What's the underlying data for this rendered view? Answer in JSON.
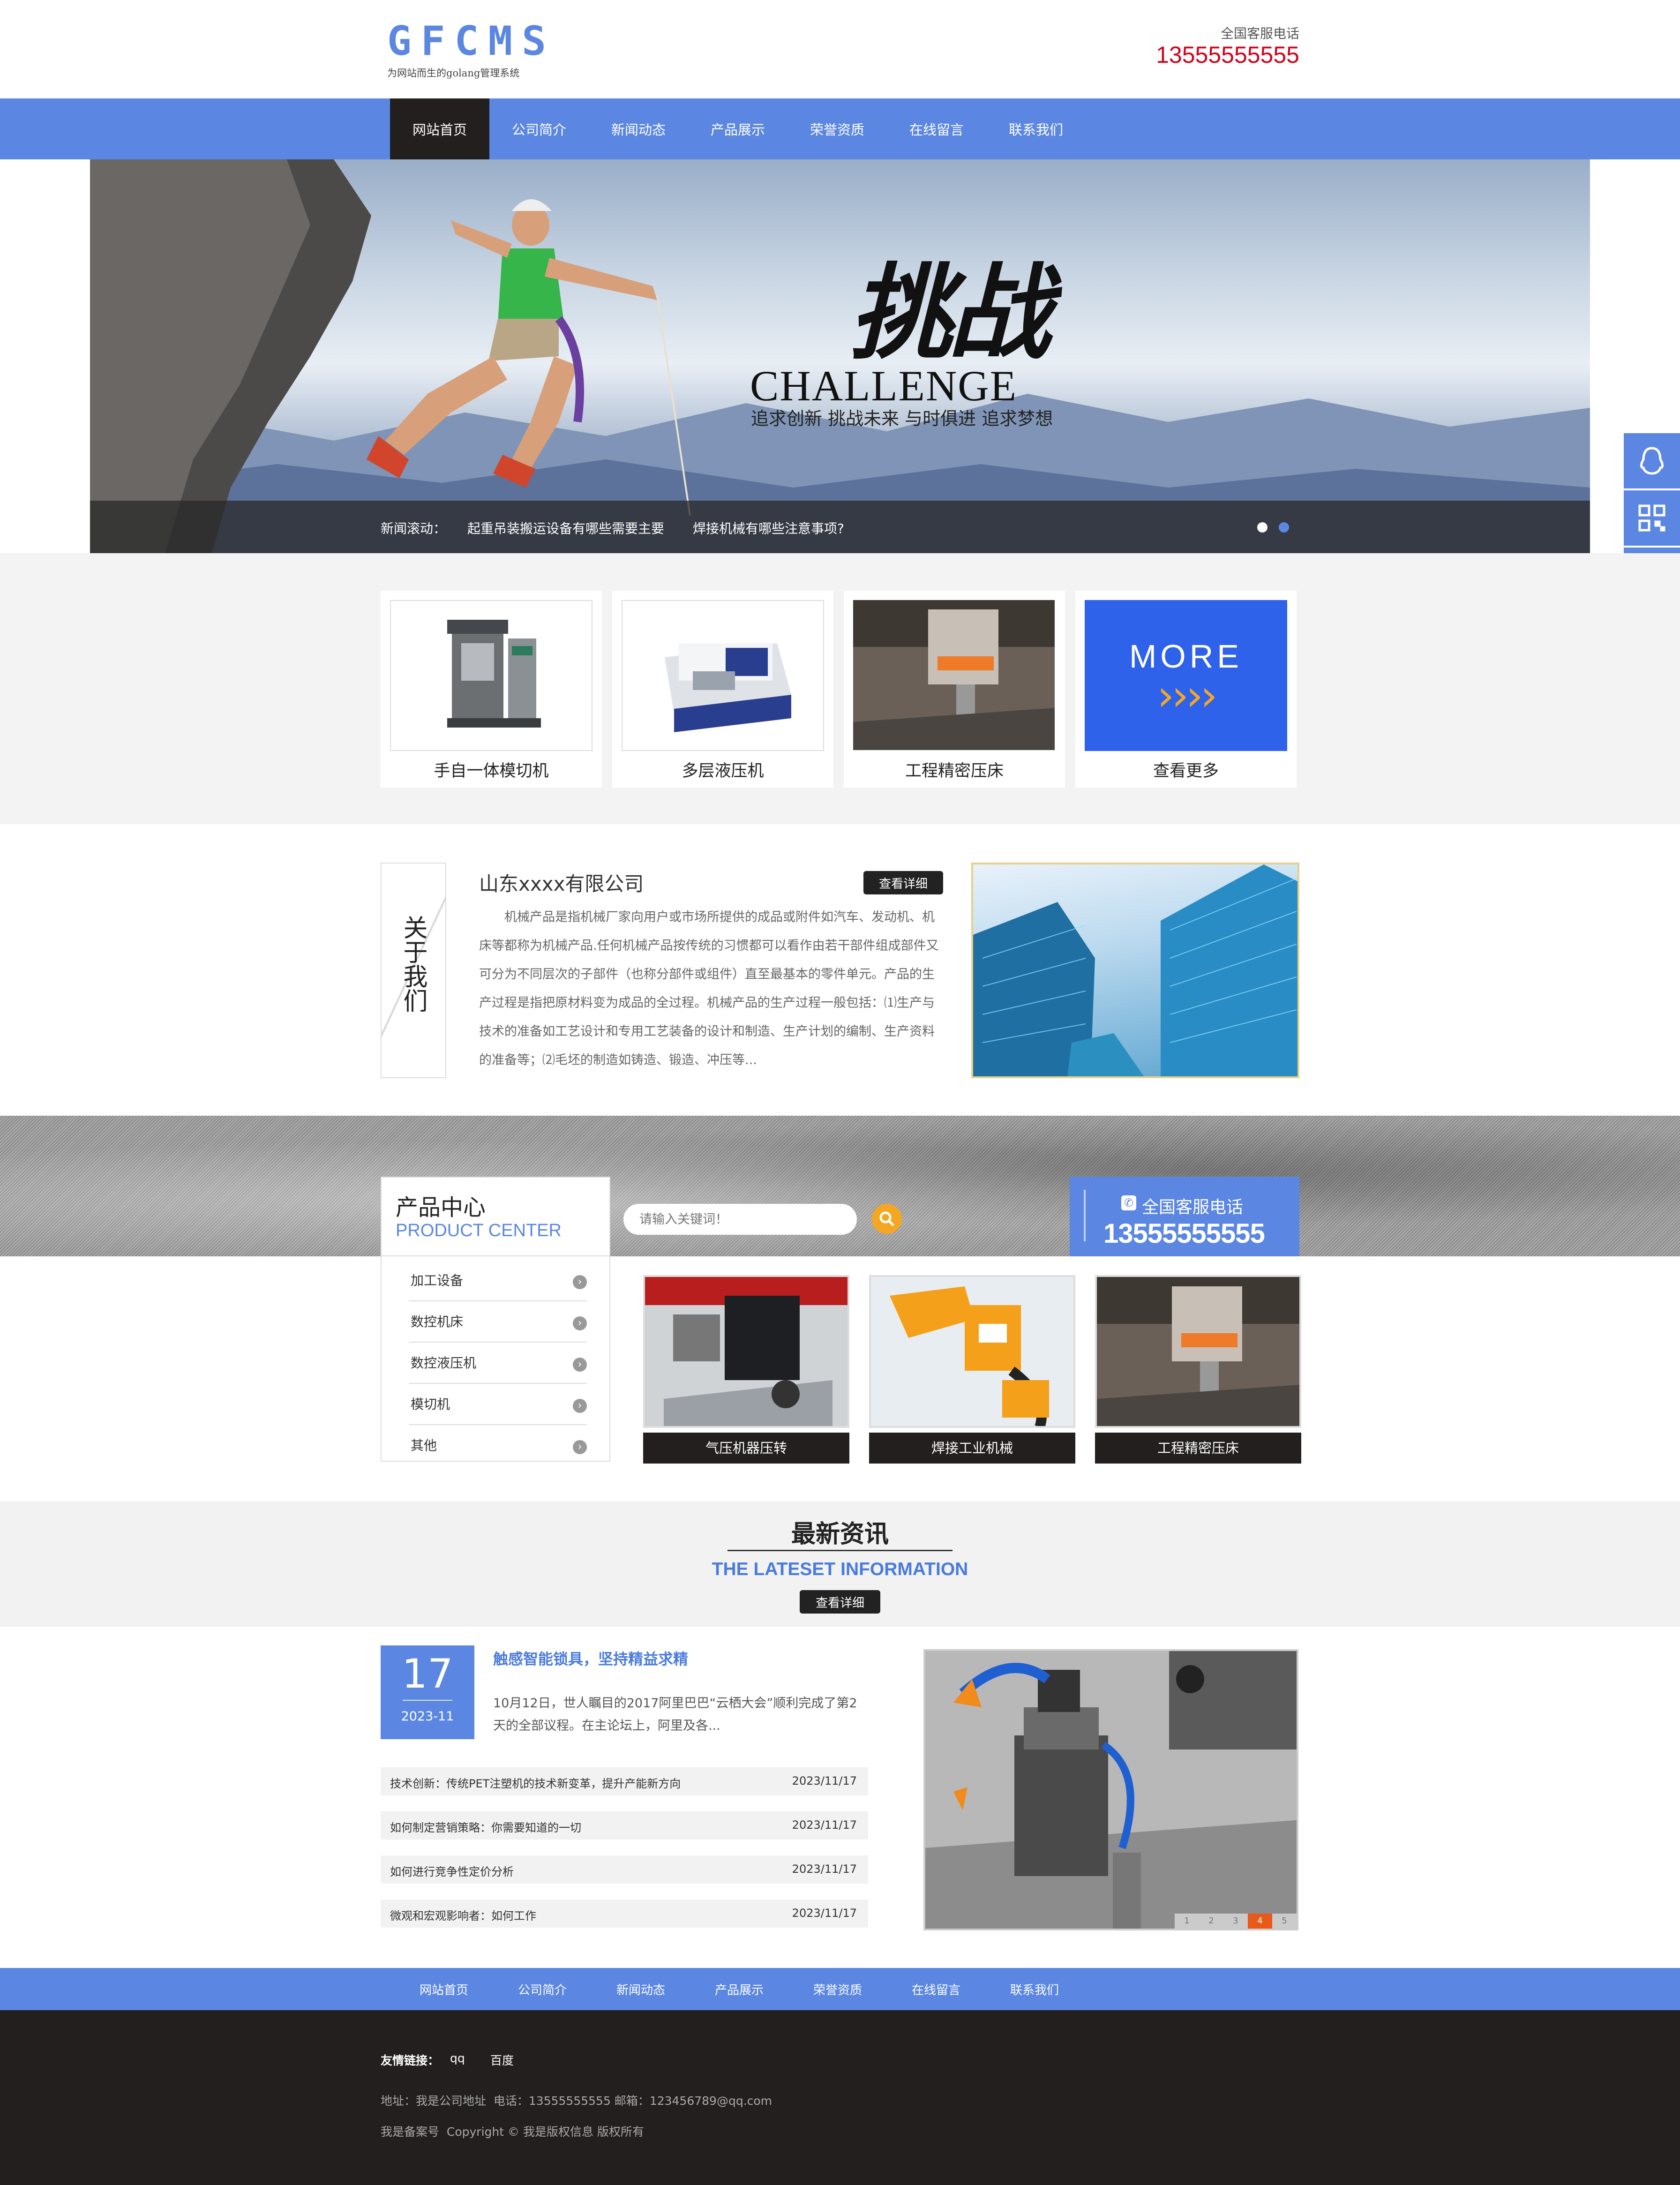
{
  "header": {
    "logo_text": "GFCMS",
    "logo_slogan": "为网站而生的golang管理系统",
    "hotline_label": "全国客服电话",
    "hotline_number": "13555555555"
  },
  "nav": {
    "items": [
      "网站首页",
      "公司简介",
      "新闻动态",
      "产品展示",
      "荣誉资质",
      "在线留言",
      "联系我们"
    ],
    "active_index": 0
  },
  "banner": {
    "title_cn": "挑战",
    "title_en": "CHALLENGE",
    "slogan": "追求创新 挑战未来 与时俱进 追求梦想",
    "ticker_label": "新闻滚动：",
    "ticker_items": [
      "起重吊装搬运设备有哪些需要主要",
      "焊接机械有哪些注意事项?"
    ],
    "slide_count": 2,
    "active_slide": 1
  },
  "featured": {
    "items": [
      {
        "label": "手自一体模切机",
        "icon": "press-machine-photo"
      },
      {
        "label": "多层液压机",
        "icon": "lathe-machine-photo"
      },
      {
        "label": "工程精密压床",
        "icon": "precision-press-photo"
      },
      {
        "label": "查看更多",
        "icon": "more-tile"
      }
    ],
    "more_tile_text": "MORE",
    "more_arrows": "››››"
  },
  "about": {
    "side_title": "关于我们",
    "company": "山东xxxx有限公司",
    "more_button": "查看详细",
    "description": "机械产品是指机械厂家向用户或市场所提供的成品或附件如汽车、发动机、机床等都称为机械产品.任何机械产品按传统的习惯都可以看作由若干部件组成部件又可分为不同层次的子部件（也称分部件或组件）直至最基本的零件单元。产品的生产过程是指把原材料变为成品的全过程。机械产品的生产过程一般包括：⑴生产与技术的准备如工艺设计和专用工艺装备的设计和制造、生产计划的编制、生产资料的准备等；⑵毛坯的制造如铸造、锻造、冲压等..."
  },
  "products": {
    "title_cn": "产品中心",
    "title_en": "PRODUCT CENTER",
    "search_placeholder": "请输入关键词！",
    "hotline_label": "全国客服电话",
    "hotline_number": "13555555555",
    "categories": [
      "加工设备",
      "数控机床",
      "数控液压机",
      "模切机",
      "其他"
    ],
    "items": [
      {
        "label": "气压机器压转"
      },
      {
        "label": "焊接工业机械"
      },
      {
        "label": "工程精密压床"
      }
    ]
  },
  "news": {
    "title_cn": "最新资讯",
    "title_en": "THE LATESET INFORMATION",
    "more_button": "查看详细",
    "featured": {
      "day": "17",
      "month": "2023-11",
      "title": "触感智能锁具，坚持精益求精",
      "summary": "10月12日，世人瞩目的2017阿里巴巴“云栖大会”顺利完成了第2天的全部议程。在主论坛上，阿里及各..."
    },
    "list": [
      {
        "title": "技术创新：传统PET注塑机的技术新变革，提升产能新方向",
        "date": "2023/11/17"
      },
      {
        "title": "如何制定营销策略：你需要知道的一切",
        "date": "2023/11/17"
      },
      {
        "title": "如何进行竞争性定价分析",
        "date": "2023/11/17"
      },
      {
        "title": "微观和宏观影响者：如何工作",
        "date": "2023/11/17"
      }
    ],
    "pager": [
      "1",
      "2",
      "3",
      "4",
      "5"
    ],
    "pager_active": 3
  },
  "footer": {
    "nav": [
      "网站首页",
      "公司简介",
      "新闻动态",
      "产品展示",
      "荣誉资质",
      "在线留言",
      "联系我们"
    ],
    "links_label": "友情链接：",
    "links": [
      "qq",
      "百度"
    ],
    "address": "地址：我是公司地址  电话：13555555555 邮箱：123456789@qq.com",
    "copyright": "我是备案号  Copyright © 我是版权信息 版权所有"
  },
  "side_bar": {
    "buttons": [
      "qq-icon",
      "qrcode-icon",
      "message-icon",
      "back-to-top-icon"
    ]
  },
  "colors": {
    "primary": "#5b87e2",
    "dark": "#231f1e",
    "accent_orange": "#f5a623",
    "text_blue": "#4a7bdc"
  }
}
